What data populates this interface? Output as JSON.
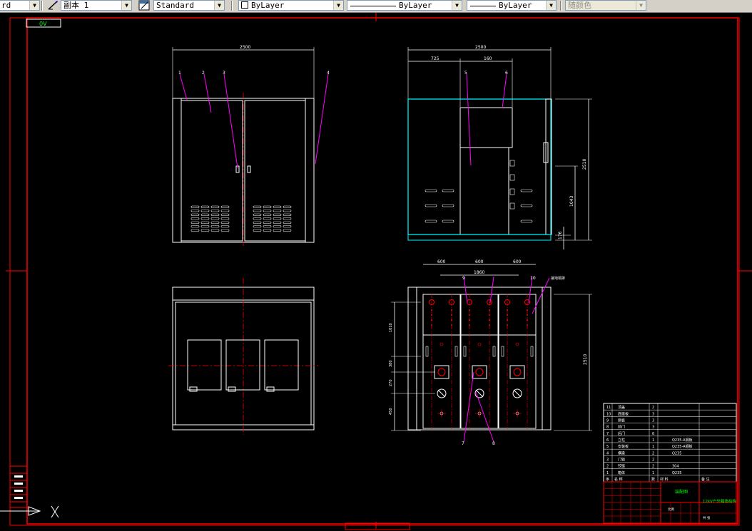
{
  "toolbar": {
    "text_style_partial": "rd",
    "dim_style": "副本 1",
    "table_style": "Standard",
    "layer": "ByLayer",
    "linetype": "ByLayer",
    "lineweight": "ByLayer",
    "plot_style": "随颜色"
  },
  "drawing": {
    "frame_label": "0V",
    "front_view": {
      "width_dim": "2500",
      "leaders": [
        "1",
        "2",
        "3",
        "4"
      ]
    },
    "side_view": {
      "width_dim": "2500",
      "sub_dims": [
        "725",
        "160"
      ],
      "height_dim": "2510",
      "leaders": [
        "5",
        "6"
      ],
      "right_dims": [
        "1043",
        "176"
      ]
    },
    "panel_view": {
      "top_dims": [
        "600",
        "600",
        "600"
      ],
      "inner_dim": "1860",
      "right_dim": "2510",
      "left_dims": [
        "1010",
        "380",
        "270",
        "450"
      ],
      "leaders": [
        "7",
        "8",
        "9",
        "10"
      ],
      "note": "接地铜排"
    }
  },
  "parts_table": {
    "rows": [
      {
        "no": "11",
        "name": "顶盖",
        "qty": "2"
      },
      {
        "no": "10",
        "name": "底座板",
        "qty": "3"
      },
      {
        "no": "9",
        "name": "侧板",
        "qty": "3"
      },
      {
        "no": "8",
        "name": "前门",
        "qty": "3"
      },
      {
        "no": "7",
        "name": "后门",
        "qty": "6"
      },
      {
        "no": "6",
        "name": "立柱",
        "qty": "1",
        "spec": "Q235-A钢板"
      },
      {
        "no": "5",
        "name": "安装板",
        "qty": "1",
        "spec": "Q235-A钢板"
      },
      {
        "no": "4",
        "name": "横梁",
        "qty": "2",
        "spec": "Q235"
      },
      {
        "no": "3",
        "name": "门锁",
        "qty": "2"
      },
      {
        "no": "2",
        "name": "铰链",
        "qty": "2",
        "spec": "304"
      },
      {
        "no": "1",
        "name": "箱体",
        "qty": "1",
        "spec": "Q235"
      }
    ],
    "header": [
      "序",
      "名  称",
      "数",
      "材  料",
      "备  注"
    ]
  },
  "title_block": {
    "company": "装配图",
    "drawing_title": "12kV户外箱体结构",
    "scale_label": "比例",
    "sheet": "共 张"
  },
  "colors": {
    "frame": "#ff0000",
    "geometry": "#ffffff",
    "leader": "#ff00ff",
    "section": "#00ffff",
    "text_green": "#00ff00",
    "dimension": "#ff3030"
  }
}
